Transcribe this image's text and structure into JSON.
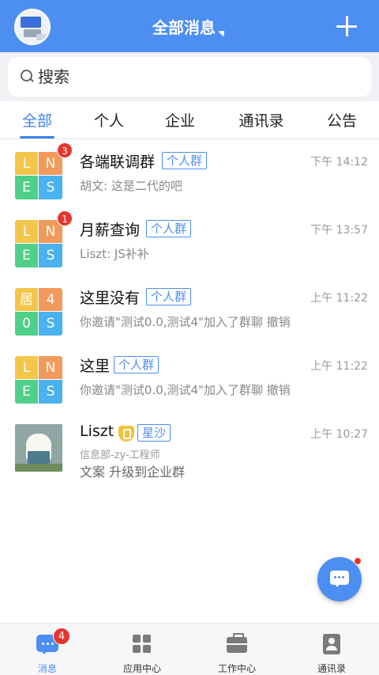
{
  "header": {
    "title": "全部消息",
    "add_icon": "plus-icon"
  },
  "search": {
    "placeholder": "搜索"
  },
  "tabs": [
    {
      "label": "全部",
      "active": true
    },
    {
      "label": "个人",
      "active": false
    },
    {
      "label": "企业",
      "active": false
    },
    {
      "label": "通讯录",
      "active": false
    },
    {
      "label": "公告",
      "active": false
    }
  ],
  "conversations": [
    {
      "grid": [
        "L",
        "N",
        "E",
        "S"
      ],
      "badge": "3",
      "name": "各端联调群",
      "tag": "个人群",
      "time": "下午 14:12",
      "preview": "胡文: 这是二代的吧"
    },
    {
      "grid": [
        "L",
        "N",
        "E",
        "S"
      ],
      "badge": "1",
      "name": "月薪查询",
      "tag": "个人群",
      "time": "下午 13:57",
      "preview": "Liszt: JS补补"
    },
    {
      "grid": [
        "居",
        "4",
        "0",
        "S"
      ],
      "name": "这里没有",
      "tag": "个人群",
      "time": "上午 11:22",
      "preview": "你邀请\"测试0.0,测试4\"加入了群聊 撤销"
    },
    {
      "grid": [
        "L",
        "N",
        "E",
        "S"
      ],
      "name": "这里",
      "tag": "个人群",
      "time": "上午 11:22",
      "preview": "你邀请\"测试0.0,测试4\"加入了群聊 撤销"
    },
    {
      "name": "Liszt",
      "tag": "星沙",
      "time": "上午 10:27",
      "subtitle": "信息部-zy-工程师",
      "preview": "文案  升级到企业群"
    }
  ],
  "bottom_nav": [
    {
      "label": "消息",
      "icon": "message-icon",
      "badge": "4",
      "active": true
    },
    {
      "label": "应用中心",
      "icon": "apps-icon",
      "active": false
    },
    {
      "label": "工作中心",
      "icon": "briefcase-icon",
      "active": false
    },
    {
      "label": "通讯录",
      "icon": "contacts-icon",
      "active": false
    }
  ],
  "colors": {
    "brand_blue": "#4d8ef2",
    "active_tab": "#3d82f0",
    "badge_red": "#e5352c"
  }
}
